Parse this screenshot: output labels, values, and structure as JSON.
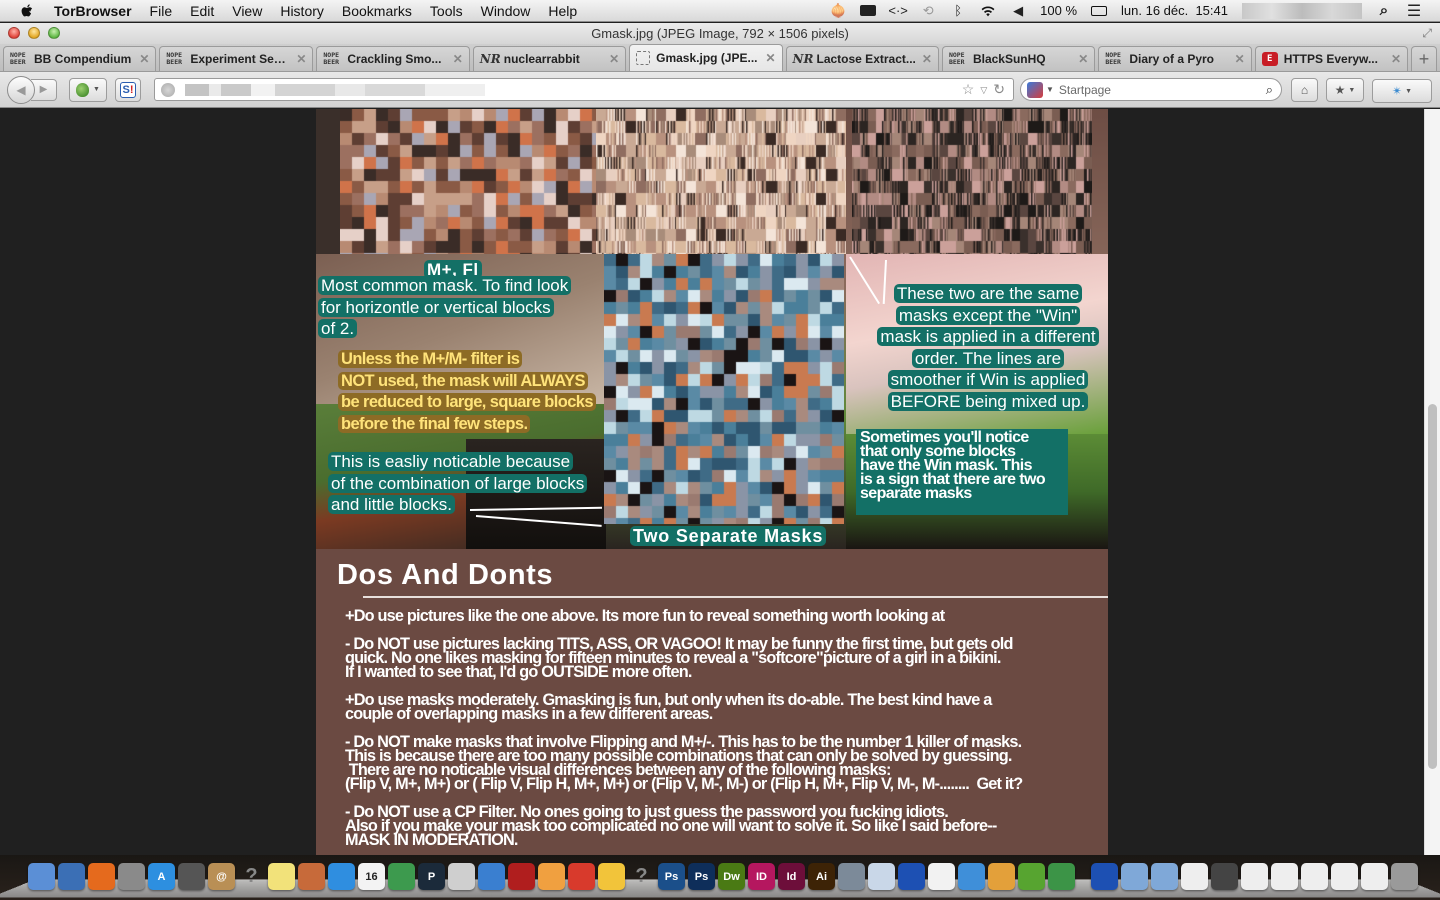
{
  "menubar": {
    "app_name": "TorBrowser",
    "menus": [
      "File",
      "Edit",
      "View",
      "History",
      "Bookmarks",
      "Tools",
      "Window",
      "Help"
    ],
    "status_icons": [
      "tor-onion-icon",
      "keyboard-icon",
      "code-arrows-icon",
      "time-machine-icon",
      "bluetooth-icon",
      "wifi-icon",
      "volume-icon"
    ],
    "battery": "100 %",
    "datetime": "lun. 16 déc.  15:41"
  },
  "window": {
    "title": "Gmask.jpg (JPEG Image, 792 × 1506 pixels)"
  },
  "tabs": [
    {
      "label": "BB Compendium",
      "favicon": "nope-beer",
      "active": false
    },
    {
      "label": "Experiment Sec...",
      "favicon": "nope-beer",
      "active": false
    },
    {
      "label": "Crackling Smo...",
      "favicon": "nope-beer",
      "active": false
    },
    {
      "label": "nuclearrabbit",
      "favicon": "nr",
      "active": false
    },
    {
      "label": "Gmask.jpg (JPE...",
      "favicon": "image-placeholder",
      "active": true
    },
    {
      "label": "Lactose Extract...",
      "favicon": "nr",
      "active": false
    },
    {
      "label": "BlackSunHQ",
      "favicon": "nope-beer",
      "active": false
    },
    {
      "label": "Diary of a Pyro",
      "favicon": "nope-beer",
      "active": false
    },
    {
      "label": "HTTPS Everyw...",
      "favicon": "https-everywhere",
      "active": false
    }
  ],
  "favicon_text": {
    "nope_beer_line1": "NOPE",
    "nope_beer_line2": "BEER",
    "nr": "NR",
    "https": "E"
  },
  "toolbar": {
    "url_value": "",
    "search_placeholder": "Startpage",
    "search_engine": "Startpage"
  },
  "image": {
    "captions": {
      "m_plus_fl": "M+, Fl",
      "most_common": [
        "Most common mask. To find look",
        "for horizontle or vertical blocks",
        "of 2."
      ],
      "unless": [
        "Unless the M+/M- filter is",
        "NOT used, the mask will ALWAYS",
        "be reduced to large, square blocks",
        "before the final few steps."
      ],
      "easily": [
        "This is easliy noticable because",
        "of the combination of large blocks",
        "and little blocks."
      ],
      "two_separate": "Two Separate Masks",
      "same_masks": [
        "These two are the same",
        "masks except the \"Win\"",
        "mask is applied in a different",
        "order. The lines are",
        "smoother if Win is applied",
        "BEFORE being mixed up."
      ],
      "sometimes": [
        "Sometimes you'll notice",
        "that only some blocks",
        "have the Win mask. This",
        "is a sign that there are two",
        "separate masks"
      ]
    },
    "dos_and_donts": {
      "heading": "Dos And Donts",
      "items": [
        [
          "+Do use pictures like the one above. Its more fun to reveal something worth looking at"
        ],
        [
          "- Do NOT use pictures lacking TITS, ASS, OR VAGOO! It may be funny the first time, but gets old",
          "quick. No one likes masking for fifteen minutes to reveal a \"softcore\"picture of a girl in a bikini.",
          "If I wanted to see that, I'd go OUTSIDE more often."
        ],
        [
          "+Do use masks moderately. Gmasking is fun, but only when its do-able. The best kind have a",
          "couple  of overlapping masks  in a few different areas."
        ],
        [
          "- Do NOT make masks that involve Flipping and M+/-. This has to be the number 1 killer of masks.",
          "This is because there are too many possible combinations that can only be solved by guessing.",
          " There are no noticable visual differences between any of the following masks:",
          "(Flip V, M+, M+) or ( Flip V, Flip H, M+, M+) or (Flip V, M-, M-) or (Flip H, M+, Flip V, M-, M-........  Get it?"
        ],
        [
          "- Do NOT use a CP Filter. No ones going to just guess the password you fucking idiots.",
          "Also if you make your mask too complicated no one will want to solve it. So like I said before--",
          "MASK IN MODERATION."
        ]
      ]
    }
  },
  "scroll": {
    "position_fraction": 0.78,
    "visible_fraction": 0.5
  },
  "dock": {
    "apps": [
      {
        "name": "finder",
        "label": "",
        "color": "#5b8fd6"
      },
      {
        "name": "thunderbird",
        "label": "",
        "color": "#3b6fb5"
      },
      {
        "name": "firefox",
        "label": "",
        "color": "#e56a1d"
      },
      {
        "name": "launchpad",
        "label": "",
        "color": "#8a8a8a"
      },
      {
        "name": "app-store",
        "label": "A",
        "color": "#2d8fe0"
      },
      {
        "name": "photo-booth",
        "label": "",
        "color": "#555555"
      },
      {
        "name": "address-book",
        "label": "@",
        "color": "#b98f55"
      },
      {
        "name": "unknown-app",
        "label": "?",
        "color": "transparent"
      },
      {
        "name": "stickies",
        "label": "",
        "color": "#f2e27a"
      },
      {
        "name": "keynote",
        "label": "",
        "color": "#c76a3a"
      },
      {
        "name": "dropbox",
        "label": "",
        "color": "#2f8ee0"
      },
      {
        "name": "calendar",
        "label": "16",
        "color": "#f3f3f3"
      },
      {
        "name": "numbers",
        "label": "",
        "color": "#3d9a4e"
      },
      {
        "name": "pockity",
        "label": "P",
        "color": "#1b2a3a"
      },
      {
        "name": "printer",
        "label": "",
        "color": "#cfcfcf"
      },
      {
        "name": "itunes",
        "label": "",
        "color": "#3a7fd0"
      },
      {
        "name": "red-app",
        "label": "",
        "color": "#b01e1e"
      },
      {
        "name": "pages",
        "label": "",
        "color": "#f0a040"
      },
      {
        "name": "tomato-app",
        "label": "",
        "color": "#d83a2c"
      },
      {
        "name": "cyberduck",
        "label": "",
        "color": "#f2c43a"
      },
      {
        "name": "unknown-app-2",
        "label": "?",
        "color": "transparent"
      },
      {
        "name": "photoshop",
        "label": "Ps",
        "color": "#1b4f8a"
      },
      {
        "name": "photoshop-2",
        "label": "Ps",
        "color": "#0e2e5a"
      },
      {
        "name": "dreamweaver",
        "label": "Dw",
        "color": "#4a7a14"
      },
      {
        "name": "indesign",
        "label": "ID",
        "color": "#b5175f"
      },
      {
        "name": "indesign-2",
        "label": "Id",
        "color": "#6d0e3a"
      },
      {
        "name": "illustrator",
        "label": "Ai",
        "color": "#3d2306"
      },
      {
        "name": "automator",
        "label": "",
        "color": "#7c8a99"
      },
      {
        "name": "preview",
        "label": "",
        "color": "#c9d7e8"
      },
      {
        "name": "transmit",
        "label": "",
        "color": "#1d50b3"
      },
      {
        "name": "libreoffice",
        "label": "",
        "color": "#f2f2f2"
      },
      {
        "name": "safari",
        "label": "",
        "color": "#3f8fd9"
      },
      {
        "name": "archive-utility",
        "label": "",
        "color": "#e3a03a"
      },
      {
        "name": "tor-browser",
        "label": "",
        "color": "#57a430"
      },
      {
        "name": "vidalia",
        "label": "",
        "color": "#3c9447"
      },
      {
        "name": "transmit-2",
        "label": "",
        "color": "#1d50b3"
      },
      {
        "name": "applications-folder",
        "label": "",
        "color": "#7fa8d8"
      },
      {
        "name": "documents-folder",
        "label": "",
        "color": "#7fa8d8"
      },
      {
        "name": "minimized-window-1",
        "label": "",
        "color": "#eeeeee"
      },
      {
        "name": "minimized-window-2",
        "label": "",
        "color": "#444444"
      },
      {
        "name": "minimized-window-3",
        "label": "",
        "color": "#eeeeee"
      },
      {
        "name": "minimized-window-4",
        "label": "",
        "color": "#eeeeee"
      },
      {
        "name": "minimized-window-5",
        "label": "",
        "color": "#eeeeee"
      },
      {
        "name": "minimized-window-6",
        "label": "",
        "color": "#eeeeee"
      },
      {
        "name": "minimized-window-7",
        "label": "",
        "color": "#eeeeee"
      },
      {
        "name": "trash",
        "label": "",
        "color": "#9a9a9a"
      }
    ]
  }
}
